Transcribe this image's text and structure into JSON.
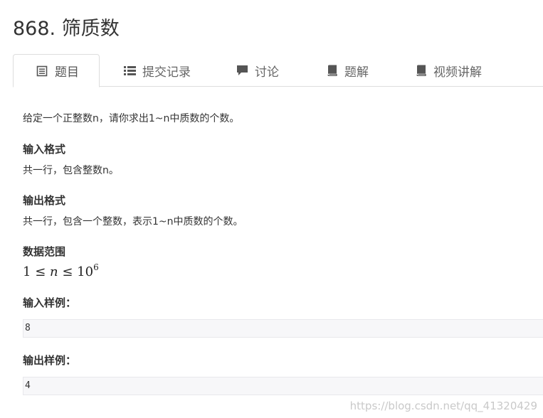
{
  "problem": {
    "title": "868. 筛质数"
  },
  "tabs": [
    {
      "label": "题目",
      "icon": "document-list-icon",
      "active": true
    },
    {
      "label": "提交记录",
      "icon": "list-icon",
      "active": false
    },
    {
      "label": "讨论",
      "icon": "comment-icon",
      "active": false
    },
    {
      "label": "题解",
      "icon": "book-icon",
      "active": false
    },
    {
      "label": "视频讲解",
      "icon": "book-icon",
      "active": false
    }
  ],
  "content": {
    "description": "给定一个正整数n，请你求出1~n中质数的个数。",
    "input_format_title": "输入格式",
    "input_format_text": "共一行，包含整数n。",
    "output_format_title": "输出格式",
    "output_format_text": "共一行，包含一个整数，表示1~n中质数的个数。",
    "range_title": "数据范围",
    "range": {
      "lhs": "1",
      "le1": "≤",
      "var": "n",
      "le2": "≤",
      "base": "10",
      "exp": "6"
    },
    "sample_input_title": "输入样例：",
    "sample_input": "8",
    "sample_output_title": "输出样例：",
    "sample_output": "4"
  },
  "watermark": "https://blog.csdn.net/qq_41320429",
  "colors": {
    "text": "#333333",
    "tab_border": "#dddddd",
    "code_bg": "#f7f7f9",
    "icon": "#555555"
  }
}
